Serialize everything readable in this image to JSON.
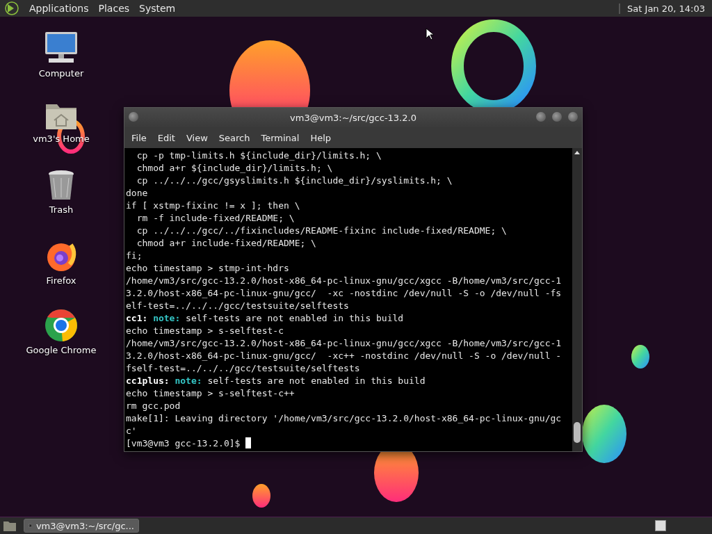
{
  "top_panel": {
    "menus": [
      "Applications",
      "Places",
      "System"
    ],
    "clock": "Sat Jan 20, 14:03"
  },
  "desktop_icons": [
    {
      "kind": "computer",
      "label": "Computer"
    },
    {
      "kind": "home",
      "label": "vm3's Home"
    },
    {
      "kind": "trash",
      "label": "Trash"
    },
    {
      "kind": "firefox",
      "label": "Firefox"
    },
    {
      "kind": "chrome",
      "label": "Google Chrome"
    }
  ],
  "window": {
    "title": "vm3@vm3:~/src/gcc-13.2.0",
    "menus": [
      "File",
      "Edit",
      "View",
      "Search",
      "Terminal",
      "Help"
    ],
    "lines": [
      {
        "kind": "plain",
        "text": "  cp -p tmp-limits.h ${include_dir}/limits.h; \\"
      },
      {
        "kind": "plain",
        "text": "  chmod a+r ${include_dir}/limits.h; \\"
      },
      {
        "kind": "plain",
        "text": "  cp ../../../gcc/gsyslimits.h ${include_dir}/syslimits.h; \\"
      },
      {
        "kind": "plain",
        "text": "done"
      },
      {
        "kind": "plain",
        "text": "if [ xstmp-fixinc != x ]; then \\"
      },
      {
        "kind": "plain",
        "text": "  rm -f include-fixed/README; \\"
      },
      {
        "kind": "plain",
        "text": "  cp ../../../gcc/../fixincludes/README-fixinc include-fixed/README; \\"
      },
      {
        "kind": "plain",
        "text": "  chmod a+r include-fixed/README; \\"
      },
      {
        "kind": "plain",
        "text": "fi;"
      },
      {
        "kind": "plain",
        "text": "echo timestamp > stmp-int-hdrs"
      },
      {
        "kind": "plain",
        "text": "/home/vm3/src/gcc-13.2.0/host-x86_64-pc-linux-gnu/gcc/xgcc -B/home/vm3/src/gcc-1"
      },
      {
        "kind": "plain",
        "text": "3.2.0/host-x86_64-pc-linux-gnu/gcc/  -xc -nostdinc /dev/null -S -o /dev/null -fs"
      },
      {
        "kind": "plain",
        "text": "elf-test=../../../gcc/testsuite/selftests"
      },
      {
        "kind": "diagnostic",
        "prog": "cc1:",
        "tag": "note:",
        "text": " self-tests are not enabled in this build"
      },
      {
        "kind": "plain",
        "text": "echo timestamp > s-selftest-c"
      },
      {
        "kind": "plain",
        "text": "/home/vm3/src/gcc-13.2.0/host-x86_64-pc-linux-gnu/gcc/xgcc -B/home/vm3/src/gcc-1"
      },
      {
        "kind": "plain",
        "text": "3.2.0/host-x86_64-pc-linux-gnu/gcc/  -xc++ -nostdinc /dev/null -S -o /dev/null -"
      },
      {
        "kind": "plain",
        "text": "fself-test=../../../gcc/testsuite/selftests"
      },
      {
        "kind": "diagnostic",
        "prog": "cc1plus:",
        "tag": "note:",
        "text": " self-tests are not enabled in this build"
      },
      {
        "kind": "plain",
        "text": "echo timestamp > s-selftest-c++"
      },
      {
        "kind": "plain",
        "text": "rm gcc.pod"
      },
      {
        "kind": "plain",
        "text": "make[1]: Leaving directory '/home/vm3/src/gcc-13.2.0/host-x86_64-pc-linux-gnu/gc"
      },
      {
        "kind": "plain",
        "text": "c'"
      },
      {
        "kind": "prompt",
        "text": "[vm3@vm3 gcc-13.2.0]$ "
      }
    ]
  },
  "taskbar": {
    "tasks": [
      {
        "label": "vm3@vm3:~/src/gc...",
        "selected": true
      }
    ]
  }
}
